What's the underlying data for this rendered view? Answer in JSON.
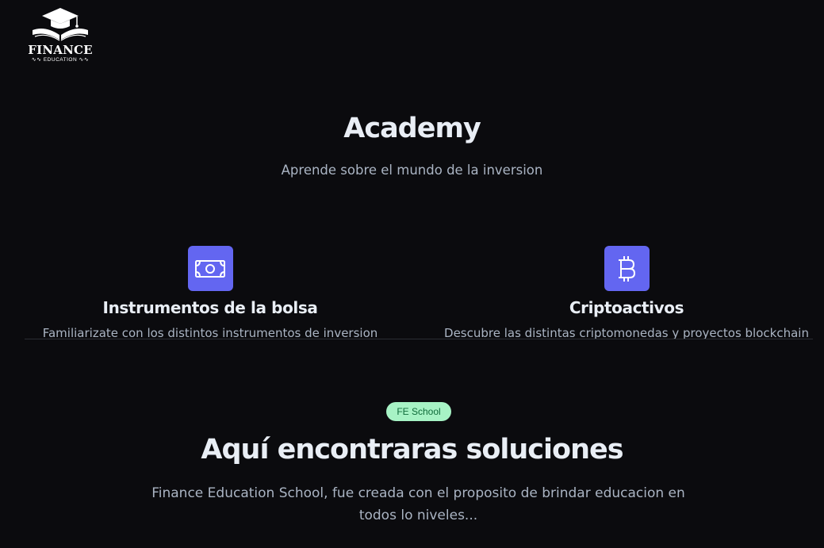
{
  "logo": {
    "wordmark": "FINANCE",
    "tagline": "EDUCATION",
    "swirl_left": "∿∿",
    "swirl_right": "∿∿"
  },
  "academy": {
    "title": "Academy",
    "subtitle": "Aprende sobre el mundo de la inversion"
  },
  "features": [
    {
      "icon": "banknote-icon",
      "title": "Instrumentos de la bolsa",
      "description": "Familiarizate con los distintos instrumentos de inversion"
    },
    {
      "icon": "bitcoin-icon",
      "title": "Criptoactivos",
      "description": "Descubre las distintas criptomonedas y proyectos blockchain"
    }
  ],
  "school": {
    "badge": "FE School",
    "title": "Aquí encontraras soluciones",
    "subtitle": "Finance Education School, fue creada con el proposito de brindar educacion en todos lo niveles..."
  },
  "colors": {
    "background": "#0b0b0e",
    "accent": "#6366f1",
    "badge_bg": "#a7f3c5",
    "badge_text": "#0f6b3a",
    "text_muted": "#aab4c3",
    "heading": "#e9eef5"
  }
}
